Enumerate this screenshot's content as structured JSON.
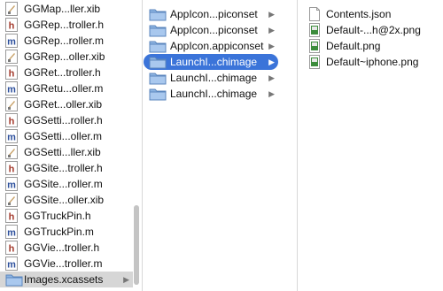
{
  "column1": {
    "items": [
      {
        "label": "GGMap...ller.xib",
        "icon": "xib-file-icon"
      },
      {
        "label": "GGRep...troller.h",
        "icon": "header-file-icon"
      },
      {
        "label": "GGRep...roller.m",
        "icon": "objc-file-icon"
      },
      {
        "label": "GGRep...oller.xib",
        "icon": "xib-file-icon"
      },
      {
        "label": "GGRet...troller.h",
        "icon": "header-file-icon"
      },
      {
        "label": "GGRetu...oller.m",
        "icon": "objc-file-icon"
      },
      {
        "label": "GGRet...oller.xib",
        "icon": "xib-file-icon"
      },
      {
        "label": "GGSetti...roller.h",
        "icon": "header-file-icon"
      },
      {
        "label": "GGSetti...oller.m",
        "icon": "objc-file-icon"
      },
      {
        "label": "GGSetti...ller.xib",
        "icon": "xib-file-icon"
      },
      {
        "label": "GGSite...troller.h",
        "icon": "header-file-icon"
      },
      {
        "label": "GGSite...roller.m",
        "icon": "objc-file-icon"
      },
      {
        "label": "GGSite...oller.xib",
        "icon": "xib-file-icon"
      },
      {
        "label": "GGTruckPin.h",
        "icon": "header-file-icon"
      },
      {
        "label": "GGTruckPin.m",
        "icon": "objc-file-icon"
      },
      {
        "label": "GGVie...troller.h",
        "icon": "header-file-icon"
      },
      {
        "label": "GGVie...troller.m",
        "icon": "objc-file-icon"
      },
      {
        "label": "Images.xcassets",
        "icon": "folder-icon",
        "arrow": "▶",
        "selected": true
      }
    ]
  },
  "column2": {
    "items": [
      {
        "label": "AppIcon...piconset",
        "icon": "folder-icon",
        "arrow": "▶"
      },
      {
        "label": "AppIcon...piconset",
        "icon": "folder-icon",
        "arrow": "▶"
      },
      {
        "label": "AppIcon.appiconset",
        "icon": "folder-icon",
        "arrow": "▶"
      },
      {
        "label": "LaunchI...chimage",
        "icon": "folder-icon",
        "arrow": "▶",
        "selected": true
      },
      {
        "label": "LaunchI...chimage",
        "icon": "folder-icon",
        "arrow": "▶"
      },
      {
        "label": "LaunchI...chimage",
        "icon": "folder-icon",
        "arrow": "▶"
      }
    ]
  },
  "column3": {
    "items": [
      {
        "label": "Contents.json",
        "icon": "document-icon"
      },
      {
        "label": "Default-...h@2x.png",
        "icon": "png-image-icon"
      },
      {
        "label": "Default.png",
        "icon": "png-image-icon"
      },
      {
        "label": "Default~iphone.png",
        "icon": "png-image-icon"
      }
    ]
  },
  "colors": {
    "selection": "#3b74d9",
    "folder": "#7fa7d6",
    "h_file": "#a33a2c",
    "m_file": "#2c4f9c"
  }
}
